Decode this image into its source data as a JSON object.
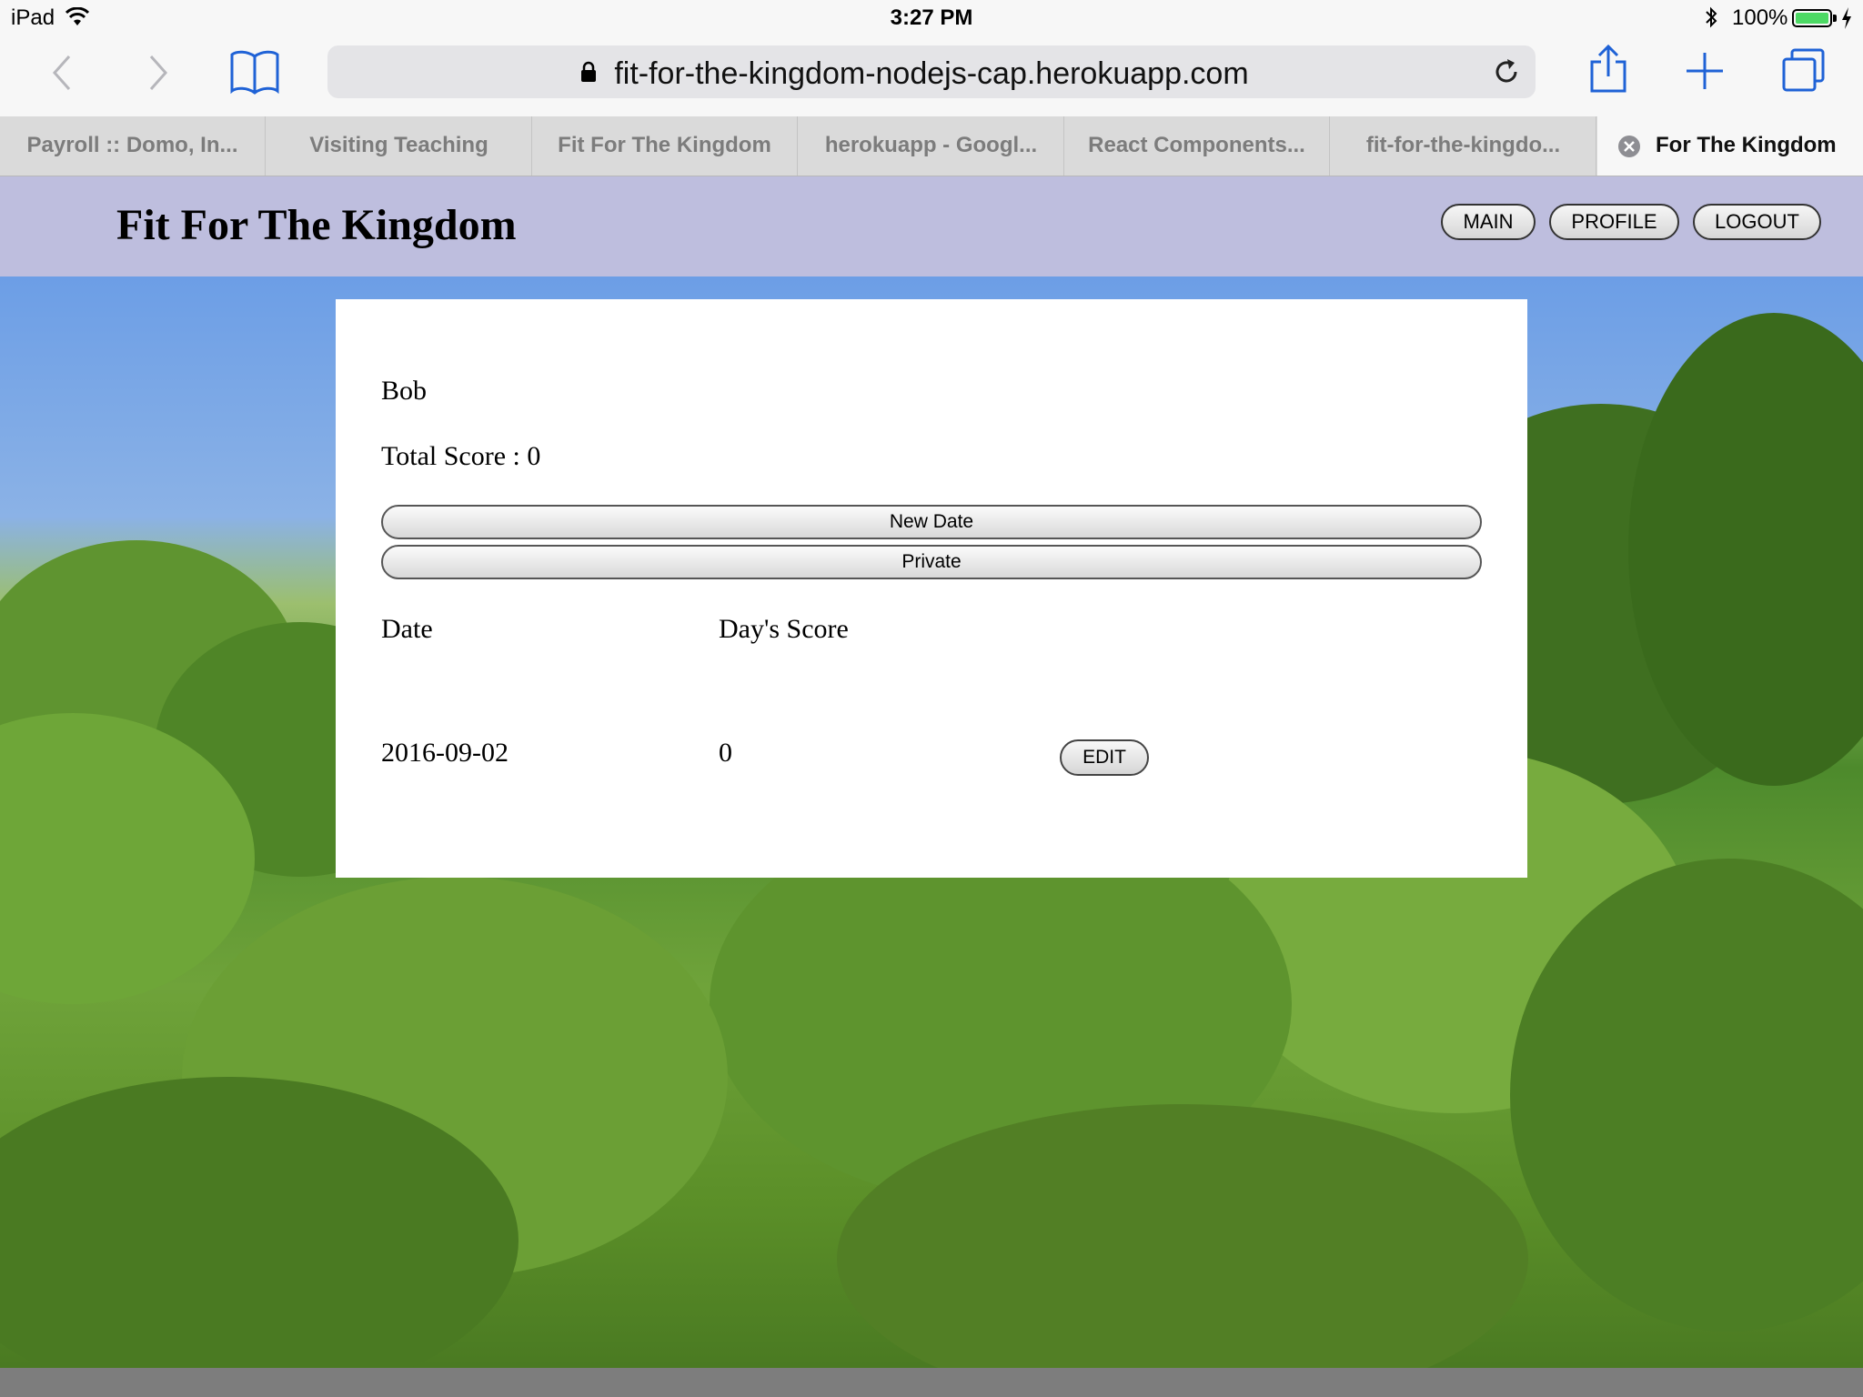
{
  "status_bar": {
    "device": "iPad",
    "time": "3:27 PM",
    "battery_percent": "100%",
    "battery_color": "#4cd964"
  },
  "browser": {
    "url": "fit-for-the-kingdom-nodejs-cap.herokuapp.com",
    "icons": [
      "back-icon",
      "forward-icon",
      "bookmarks-icon",
      "lock-icon",
      "reload-icon",
      "share-icon",
      "new-tab-icon",
      "tabs-icon"
    ],
    "tabs": [
      {
        "label": "Payroll :: Domo, In..."
      },
      {
        "label": "Visiting Teaching"
      },
      {
        "label": "Fit For The Kingdom"
      },
      {
        "label": "herokuapp - Googl..."
      },
      {
        "label": "React Components..."
      },
      {
        "label": "fit-for-the-kingdo..."
      },
      {
        "label": "For The Kingdom"
      }
    ]
  },
  "site": {
    "title": "Fit For The Kingdom",
    "header_color": "#bebede",
    "nav": {
      "main": "MAIN",
      "profile": "PROFILE",
      "logout": "LOGOUT"
    }
  },
  "profile": {
    "name": "Bob",
    "total_score": "Total Score : 0",
    "new_date_button": "New Date",
    "private_button": "Private",
    "table": {
      "headers": [
        "Date",
        "Day's Score"
      ],
      "rows": [
        {
          "date": "2016-09-02",
          "score": "0",
          "action": "EDIT"
        }
      ]
    }
  }
}
